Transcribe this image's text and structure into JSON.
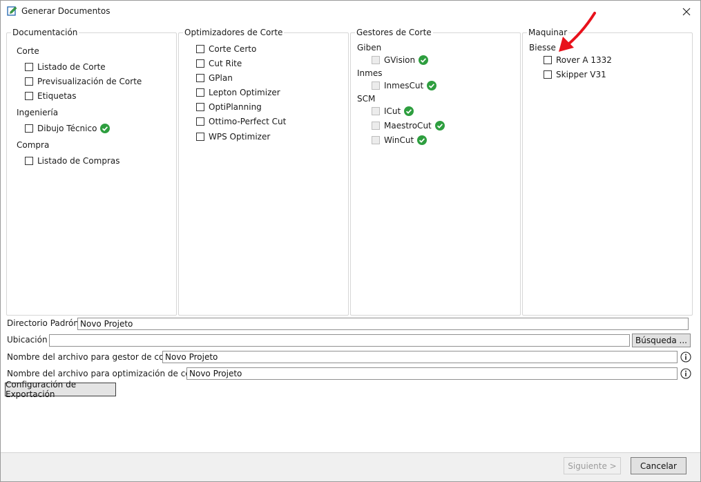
{
  "window": {
    "title": "Generar Documentos"
  },
  "groups": {
    "documentacion": {
      "legend": "Documentación",
      "categories": [
        {
          "label": "Corte",
          "items": [
            {
              "label": "Listado de Corte"
            },
            {
              "label": "Previsualización de Corte"
            },
            {
              "label": "Etiquetas"
            }
          ]
        },
        {
          "label": "Ingeniería",
          "items": [
            {
              "label": "Dibujo Técnico",
              "ok": true
            }
          ]
        },
        {
          "label": "Compra",
          "items": [
            {
              "label": "Listado de Compras"
            }
          ]
        }
      ]
    },
    "optimizadores": {
      "legend": "Optimizadores de Corte",
      "items": [
        {
          "label": "Corte Certo"
        },
        {
          "label": "Cut Rite"
        },
        {
          "label": "GPlan"
        },
        {
          "label": "Lepton Optimizer"
        },
        {
          "label": "OptiPlanning"
        },
        {
          "label": "Ottimo-Perfect Cut"
        },
        {
          "label": "WPS Optimizer"
        }
      ]
    },
    "gestores": {
      "legend": "Gestores de Corte",
      "categories": [
        {
          "label": "Giben",
          "items": [
            {
              "label": "GVision",
              "ok": true
            }
          ]
        },
        {
          "label": "Inmes",
          "items": [
            {
              "label": "InmesCut",
              "ok": true
            }
          ]
        },
        {
          "label": "SCM",
          "items": [
            {
              "label": "ICut",
              "ok": true
            },
            {
              "label": "MaestroCut",
              "ok": true
            },
            {
              "label": "WinCut",
              "ok": true
            }
          ]
        }
      ]
    },
    "maquinas": {
      "legend": "Maquinar",
      "categories": [
        {
          "label": "Biesse",
          "items": [
            {
              "label": "Rover A 1332"
            },
            {
              "label": "Skipper V31"
            }
          ]
        }
      ]
    }
  },
  "form": {
    "directorio_label": "Directorio Padrón :",
    "directorio_value": "Novo Projeto",
    "ubicacion_label": "Ubicación :",
    "ubicacion_value": "",
    "busqueda_button": "Búsqueda ...",
    "gestor_label": "Nombre del archivo para gestor de corte :",
    "gestor_value": "Novo Projeto",
    "optimizacion_label": "Nombre del archivo para optimización de corte :",
    "optimizacion_value": "Novo Projeto",
    "config_button": "Configuración de Exportación"
  },
  "footer": {
    "next_button": "Siguiente >",
    "cancel_button": "Cancelar"
  },
  "colors": {
    "check_green": "#2e9e3f",
    "annotation_red": "#e8111b"
  }
}
